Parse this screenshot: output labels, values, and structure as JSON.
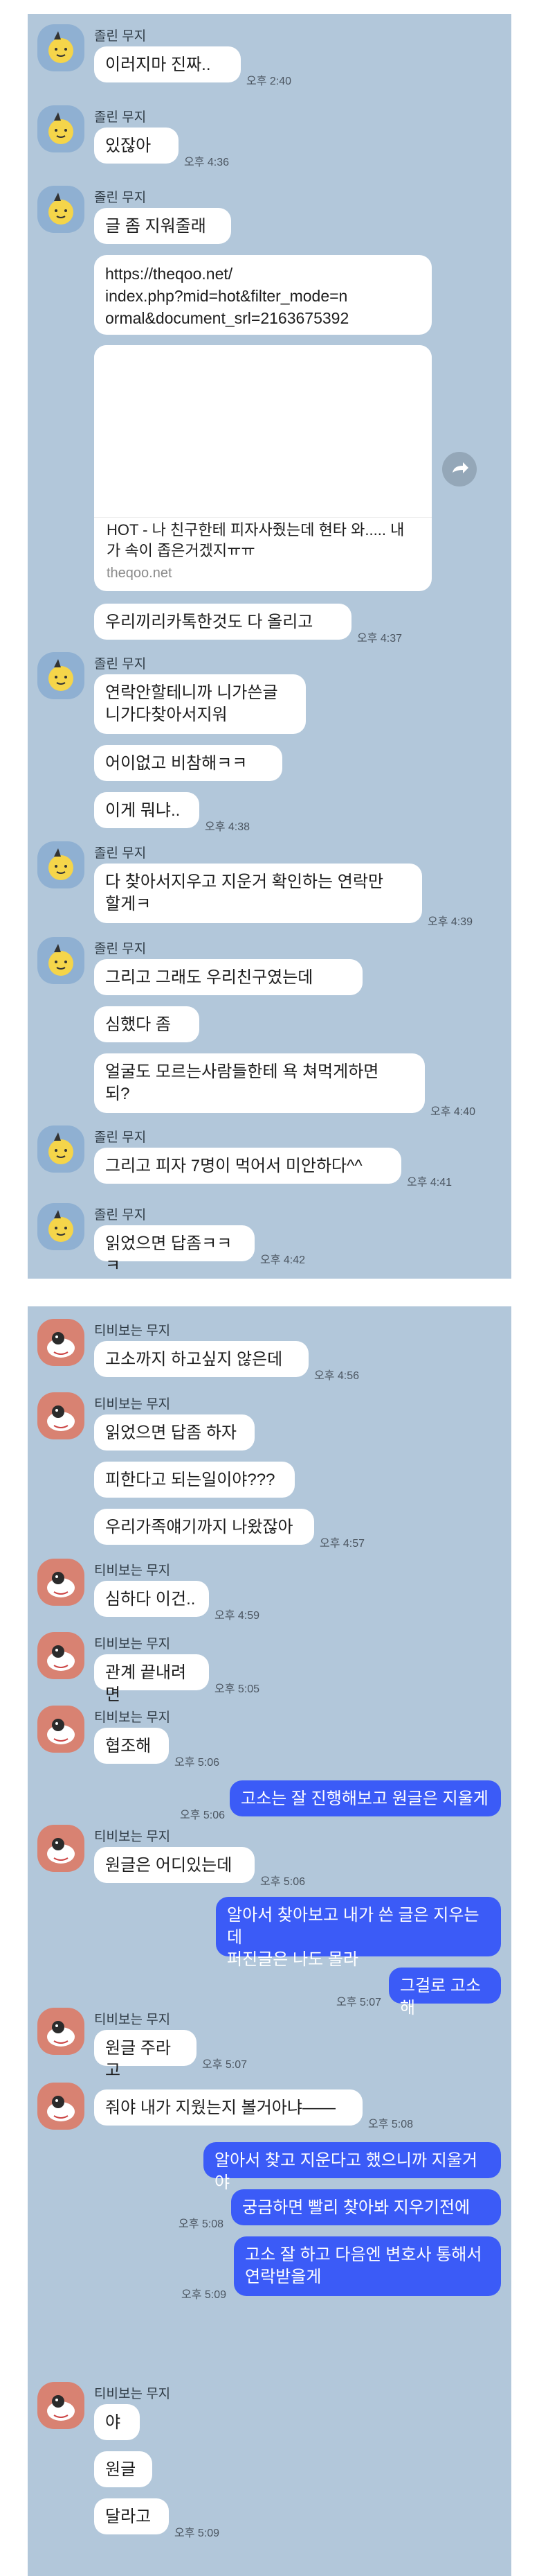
{
  "panel1": {
    "sender_a": "졸린 무지",
    "m1": {
      "text": "이러지마 진짜..",
      "time": "오후 2:40"
    },
    "m2": {
      "text": "있잖아",
      "time": "오후 4:36"
    },
    "m3": {
      "b1": "글 좀 지워줄래",
      "b2": "https://theqoo.net/\nindex.php?mid=hot&filter_mode=n\normal&document_srl=2163675392",
      "card_title": "HOT - 나 친구한테 피자사줬는데 현타 와..... 내가 속이 좁은거겠지ㅠㅠ",
      "card_domain": "theqoo.net",
      "b3": "우리끼리카톡한것도 다 올리고",
      "time": "오후 4:37"
    },
    "m4": {
      "b1": "연락안할테니까 니가쓴글\n니가다찾아서지워",
      "b2": "어이없고 비참해ㅋㅋ",
      "b3": "이게 뭐냐..",
      "time": "오후 4:38"
    },
    "m5": {
      "text": "다 찾아서지우고 지운거 확인하는 연락만\n할게ㅋ",
      "time": "오후 4:39"
    },
    "m6": {
      "b1": "그리고 그래도 우리친구였는데",
      "b2": "심했다 좀",
      "b3": "얼굴도 모르는사람들한테 욕 쳐먹게하면\n되?",
      "time": "오후 4:40"
    },
    "m7": {
      "text": "그리고 피자 7명이 먹어서 미안하다^^",
      "time": "오후 4:41"
    },
    "m8": {
      "text": "읽었으면 답좀ㅋㅋㅋ",
      "time": "오후 4:42"
    }
  },
  "panel2": {
    "sender_b": "티비보는 무지",
    "n1": {
      "text": "고소까지 하고싶지 않은데",
      "time": "오후 4:56"
    },
    "n2": {
      "b1": "읽었으면 답좀 하자",
      "b2": "피한다고 되는일이야???",
      "b3": "우리가족얘기까지 나왔잖아",
      "time": "오후 4:57"
    },
    "n3": {
      "text": "심하다 이건..",
      "time": "오후 4:59"
    },
    "n4": {
      "text": "관계 끝내려면",
      "time": "오후 5:05"
    },
    "n5": {
      "text": "협조해",
      "time": "오후 5:06"
    },
    "o1": {
      "text": "고소는 잘 진행해보고 원글은 지울게",
      "time": "오후 5:06"
    },
    "n6": {
      "text": "원글은 어디있는데",
      "time": "오후 5:06"
    },
    "o2": {
      "b1": "알아서 찾아보고 내가 쓴 글은 지우는데\n퍼진글은 나도 몰라",
      "b2": "그걸로 고소해",
      "time": "오후 5:07"
    },
    "n7": {
      "text": "원글 주라고",
      "time": "오후 5:07"
    },
    "n8": {
      "text": "줘야 내가 지웠는지 볼거아냐——",
      "time": "오후 5:08"
    },
    "o3": {
      "b1": "알아서 찾고 지운다고 했으니까 지울거야",
      "b2": "궁금하면 빨리 찾아봐 지우기전에",
      "time1": "오후 5:08",
      "b3": "고소 잘 하고 다음엔 변호사 통해서\n연락받을게",
      "time2": "오후 5:09"
    },
    "n9": {
      "b1": "야",
      "b2": "원글",
      "b3": "달라고",
      "time": "오후 5:09"
    }
  },
  "icons": {
    "avatar_a": "muzi-sleepy-avatar",
    "avatar_b": "muzi-tv-avatar",
    "share": "share-icon"
  },
  "colors": {
    "chat_bg": "#b2c7da",
    "bubble_in": "#ffffff",
    "bubble_out": "#3b5bf7",
    "avatar_a": "#8fb0d2",
    "avatar_b": "#d88272"
  }
}
